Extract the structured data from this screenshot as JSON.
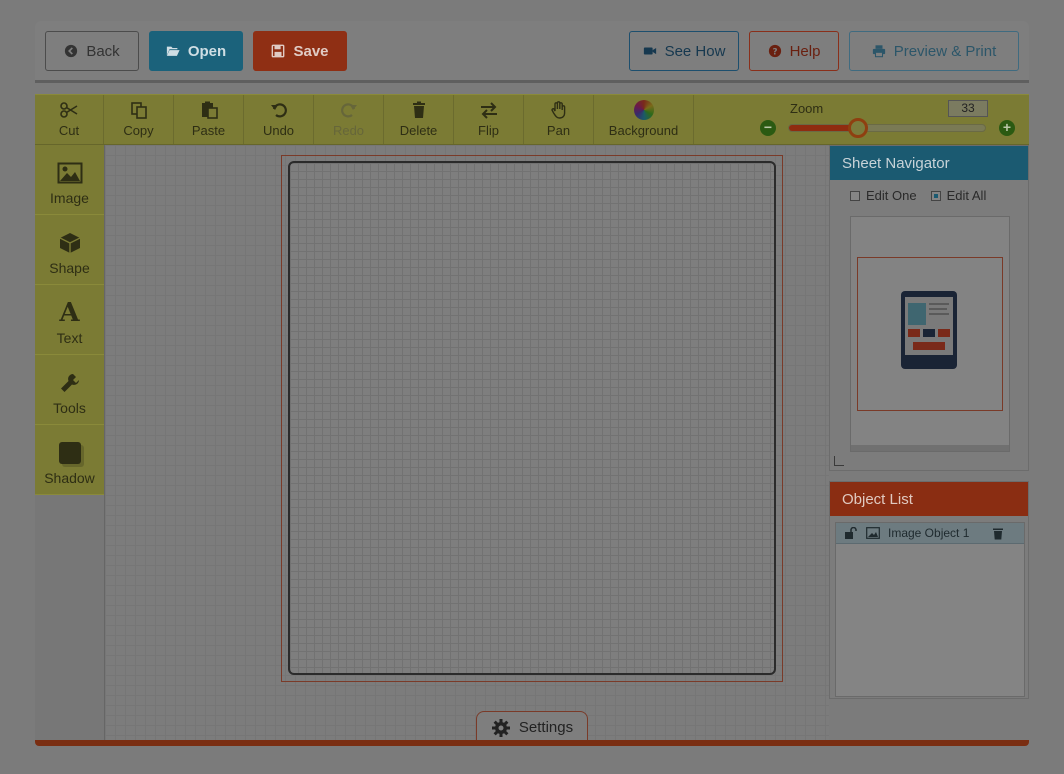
{
  "header": {
    "back_label": "Back",
    "open_label": "Open",
    "save_label": "Save",
    "seehow_label": "See How",
    "help_label": "Help",
    "preview_label": "Preview & Print"
  },
  "toolbar": {
    "cut": "Cut",
    "copy": "Copy",
    "paste": "Paste",
    "undo": "Undo",
    "redo": "Redo",
    "delete": "Delete",
    "flip": "Flip",
    "pan": "Pan",
    "background": "Background",
    "zoom_label": "Zoom",
    "zoom_value": "33",
    "zoom_fraction": 0.33
  },
  "left_panel": {
    "image": "Image",
    "shape": "Shape",
    "text": "Text",
    "tools": "Tools",
    "shadow": "Shadow"
  },
  "settings_label": "Settings",
  "sheet_navigator": {
    "title": "Sheet Navigator",
    "edit_one": "Edit One",
    "edit_all": "Edit All",
    "edit_all_checked": true,
    "edit_one_checked": false
  },
  "object_list": {
    "title": "Object List",
    "items": [
      {
        "label": "Image Object 1"
      }
    ]
  },
  "colors": {
    "toolbar_yellow": "#7b7b34",
    "open_blue": "#1b627b",
    "save_red": "#8f2f14",
    "navigator_blue": "#1b5a71",
    "objectlist_red": "#8a2d12"
  }
}
